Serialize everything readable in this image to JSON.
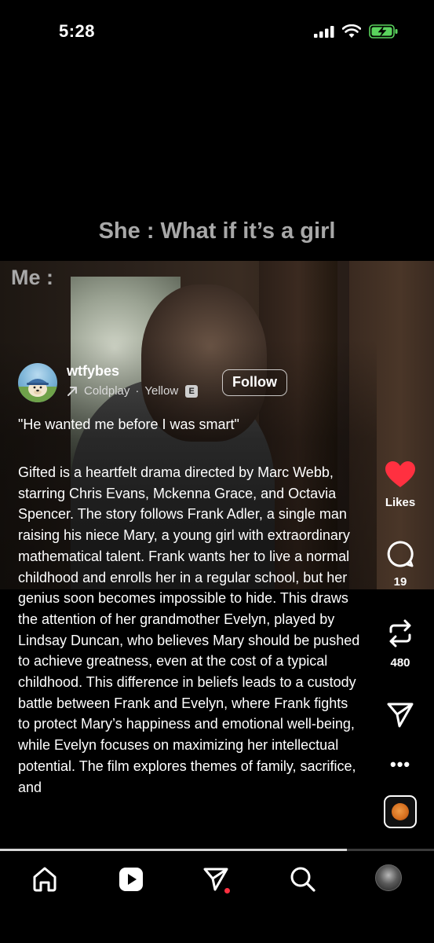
{
  "status_bar": {
    "time": "5:28",
    "icons": [
      "signal-icon",
      "wifi-icon",
      "battery-charging-icon"
    ]
  },
  "video": {
    "caption_top": "She : What if it’s a girl",
    "caption_me": "Me :"
  },
  "post": {
    "username": "wtfybes",
    "music_artist": "Coldplay",
    "music_separator": "·",
    "music_title": "Yellow",
    "explicit_badge": "E",
    "follow_label": "Follow",
    "quote": "\"He wanted me before I was smart\"",
    "description": "Gifted is a heartfelt drama directed by Marc Webb, starring Chris Evans, Mckenna Grace, and Octavia Spencer. The story follows Frank Adler, a single man raising his niece Mary, a young girl with extraordinary mathematical talent. Frank wants her to live a normal childhood and enrolls her in a regular school, but her genius soon becomes impossible to hide. This draws the attention of her grandmother Evelyn, played by Lindsay Duncan, who believes Mary should be pushed to achieve greatness, even at the cost of a typical childhood. This difference in beliefs leads to a custody battle between Frank and Evelyn, where Frank fights to protect Mary’s happiness and emotional well-being, while Evelyn focuses on maximizing her intellectual potential. The film explores themes of family, sacrifice, and"
  },
  "actions": {
    "likes_label": "Likes",
    "comments_count": "19",
    "reposts_count": "480",
    "more_label": "•••",
    "like_color": "#ff3040"
  },
  "playback": {
    "progress_fraction": 0.8
  },
  "nav": {
    "items": [
      "home-icon",
      "reels-icon",
      "messages-icon",
      "search-icon",
      "profile-avatar"
    ],
    "notification_color": "#ff3040"
  }
}
